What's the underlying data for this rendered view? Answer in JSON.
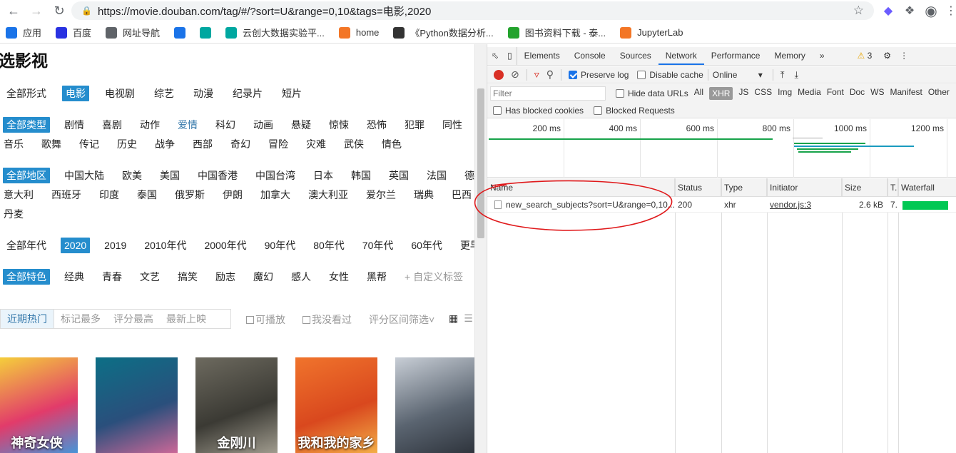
{
  "browser": {
    "url": "https://movie.douban.com/tag/#/?sort=U&range=0,10&tags=电影,2020",
    "bookmarks": [
      {
        "label": "应用",
        "icon": "apps-grid-icon",
        "color": "#1a73e8"
      },
      {
        "label": "百度",
        "icon": "baidu-paw-icon",
        "color": "#2932e1"
      },
      {
        "label": "网址导航",
        "icon": "globe-icon",
        "color": "#5f6368"
      },
      {
        "label": "",
        "icon": "cloud-icon",
        "color": "#1a73e8"
      },
      {
        "label": "",
        "icon": "bd-icon",
        "color": "#00a7a0"
      },
      {
        "label": "云创大数据实验平...",
        "icon": "bd-icon",
        "color": "#00a7a0"
      },
      {
        "label": "home",
        "icon": "jupyter-icon",
        "color": "#f37626"
      },
      {
        "label": "《Python数据分析...",
        "icon": "github-icon",
        "color": "#333333"
      },
      {
        "label": "图书资料下载 - 泰...",
        "icon": "play-icon",
        "color": "#23a32d"
      },
      {
        "label": "JupyterLab",
        "icon": "jupyter-icon",
        "color": "#f37626"
      }
    ]
  },
  "page": {
    "title": "选影视",
    "rows": [
      {
        "items": [
          "全部形式",
          "电影",
          "电视剧",
          "综艺",
          "动漫",
          "纪录片",
          "短片"
        ],
        "selected": 1
      },
      {
        "items": [
          "全部类型",
          "剧情",
          "喜剧",
          "动作",
          "爱情",
          "科幻",
          "动画",
          "悬疑",
          "惊悚",
          "恐怖",
          "犯罪",
          "同性"
        ],
        "selected": 0,
        "highlight": 4
      },
      {
        "items": [
          "音乐",
          "歌舞",
          "传记",
          "历史",
          "战争",
          "西部",
          "奇幻",
          "冒险",
          "灾难",
          "武侠",
          "情色"
        ],
        "selected": -1
      },
      {
        "items": [
          "全部地区",
          "中国大陆",
          "欧美",
          "美国",
          "中国香港",
          "中国台湾",
          "日本",
          "韩国",
          "英国",
          "法国",
          "德国"
        ],
        "selected": 0
      },
      {
        "items": [
          "意大利",
          "西班牙",
          "印度",
          "泰国",
          "俄罗斯",
          "伊朗",
          "加拿大",
          "澳大利亚",
          "爱尔兰",
          "瑞典",
          "巴西"
        ],
        "selected": -1
      },
      {
        "items": [
          "丹麦"
        ],
        "selected": -1
      },
      {
        "items": [
          "全部年代",
          "2020",
          "2019",
          "2010年代",
          "2000年代",
          "90年代",
          "80年代",
          "70年代",
          "60年代",
          "更早"
        ],
        "selected": 1
      },
      {
        "items": [
          "全部特色",
          "经典",
          "青春",
          "文艺",
          "搞笑",
          "励志",
          "魔幻",
          "感人",
          "女性",
          "黑帮",
          "+ 自定义标签"
        ],
        "selected": 0,
        "muted": 10
      }
    ],
    "sort_tabs": [
      "近期热门",
      "标记最多",
      "评分最高",
      "最新上映"
    ],
    "options": [
      "可播放",
      "我没看过",
      "评分区间筛选"
    ],
    "posters": [
      {
        "caption": "神奇女侠",
        "colors": [
          "#f5d23a",
          "#e23b6a",
          "#3a9be0"
        ]
      },
      {
        "caption": "",
        "colors": [
          "#0c6f86",
          "#2a4f7c",
          "#d86a9a"
        ]
      },
      {
        "caption": "金刚川",
        "colors": [
          "#6d6a5f",
          "#3b3a34",
          "#a8a395"
        ]
      },
      {
        "caption": "我和我的家乡",
        "colors": [
          "#f0742c",
          "#d9481e",
          "#f5b64a"
        ]
      },
      {
        "caption": "",
        "colors": [
          "#c8ced6",
          "#5a6470",
          "#2b3038"
        ]
      }
    ]
  },
  "devtools": {
    "tabs": [
      "Elements",
      "Console",
      "Sources",
      "Network",
      "Performance",
      "Memory"
    ],
    "active_tab": "Network",
    "warnings": "3",
    "preserve_log": "Preserve log",
    "disable_cache": "Disable cache",
    "throttle": "Online",
    "filter_placeholder": "Filter",
    "hide_data_urls": "Hide data URLs",
    "types": [
      "All",
      "XHR",
      "JS",
      "CSS",
      "Img",
      "Media",
      "Font",
      "Doc",
      "WS",
      "Manifest",
      "Other"
    ],
    "active_type": "XHR",
    "blocked_cookies": "Has blocked cookies",
    "blocked_requests": "Blocked Requests",
    "timeline_ticks": [
      "200 ms",
      "400 ms",
      "600 ms",
      "800 ms",
      "1000 ms",
      "1200 ms"
    ],
    "columns": [
      "Name",
      "Status",
      "Type",
      "Initiator",
      "Size",
      "T.",
      "Waterfall"
    ],
    "request": {
      "name": "new_search_subjects?sort=U&range=0,10...",
      "status": "200",
      "type": "xhr",
      "initiator": "vendor.js:3",
      "size": "2.6 kB",
      "time": "7."
    }
  }
}
